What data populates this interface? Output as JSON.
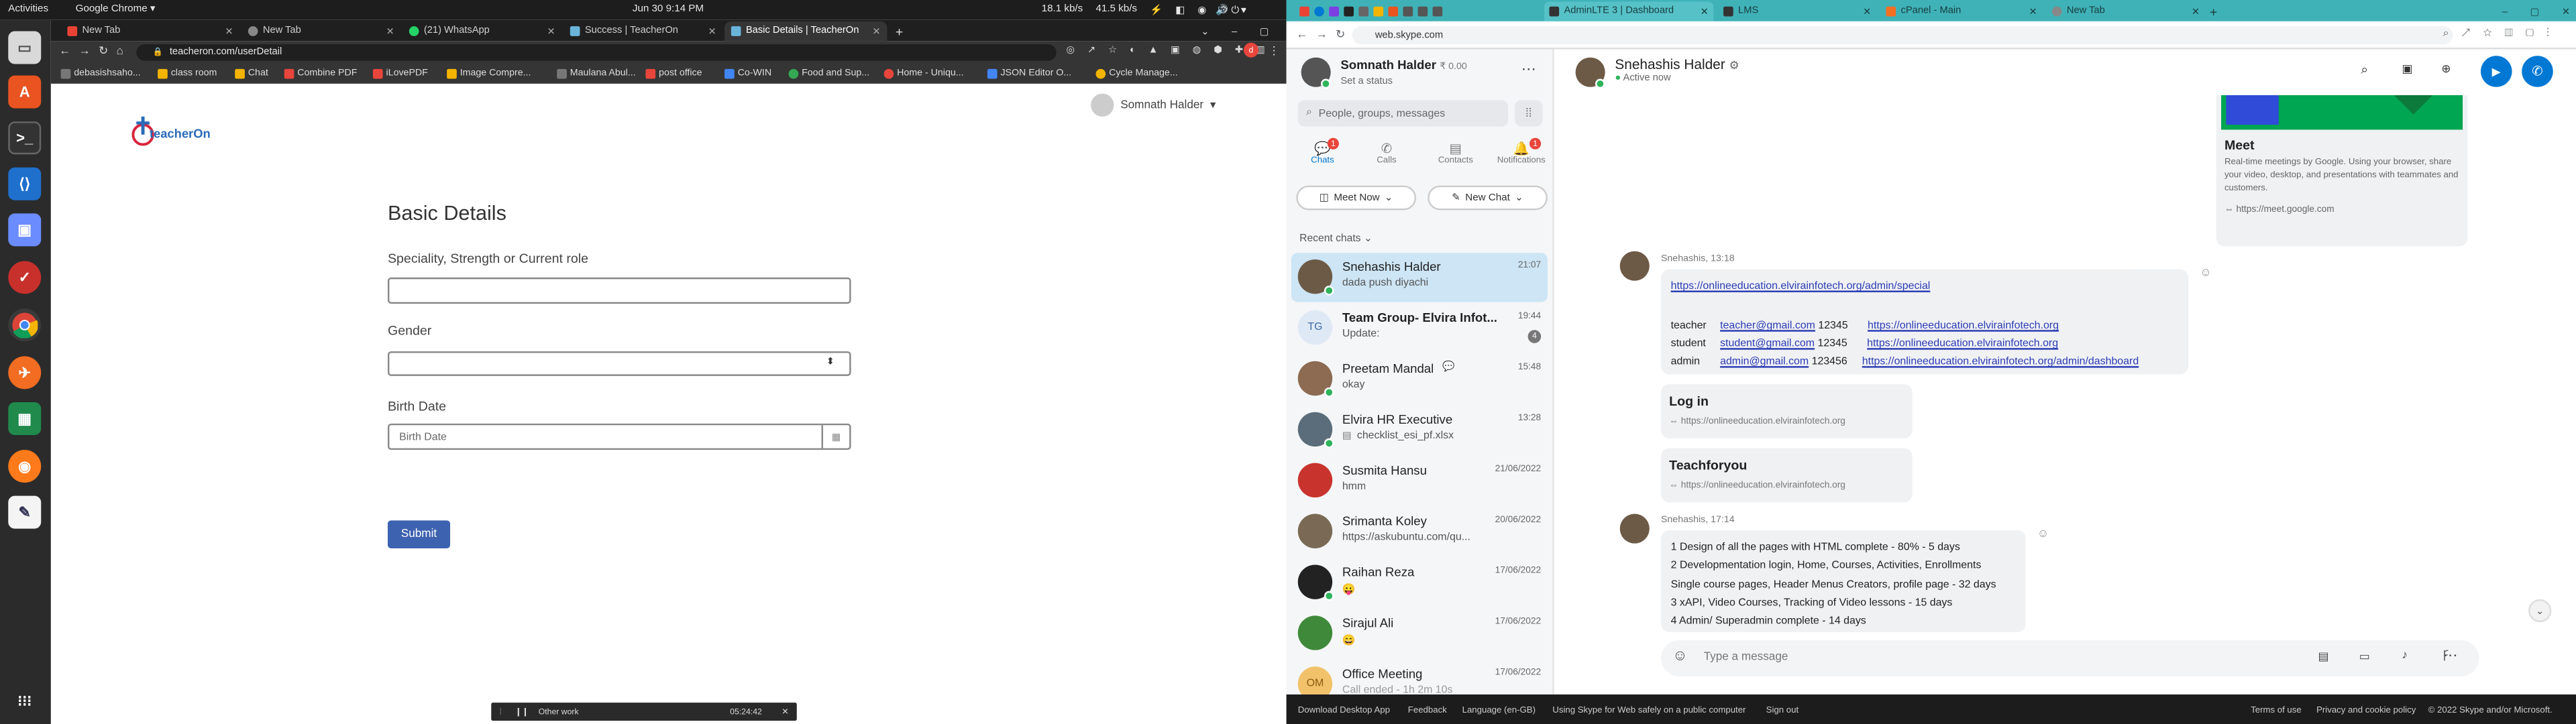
{
  "top_bar": {
    "activities": "Activities",
    "app": "Google Chrome",
    "date_time": "Jun 30  9:14 PM",
    "net1": "18.1 kb/s",
    "net2": "41.5 kb/s"
  },
  "left_browser": {
    "tabs": [
      {
        "label": "New Tab"
      },
      {
        "label": "New Tab"
      },
      {
        "label": "(21) WhatsApp"
      },
      {
        "label": "Success | TeacherOn"
      },
      {
        "label": "Basic Details | TeacherOn"
      }
    ],
    "url": "teacheron.com/userDetail",
    "bookmarks": [
      "debasishsaho...",
      "class room",
      "Chat",
      "Combine PDF",
      "iLovePDF",
      "Image Compre...",
      "Maulana Abul...",
      "post office",
      "Co-WIN",
      "Food and Sup...",
      "Home - Uniqu...",
      "JSON Editor O...",
      "Cycle Manage..."
    ],
    "page": {
      "logo_text": "teacherOn",
      "user_name": "Somnath Halder",
      "heading": "Basic Details",
      "label_role": "Speciality, Strength or Current role",
      "label_gender": "Gender",
      "label_birth": "Birth Date",
      "birth_placeholder": "Birth Date",
      "submit": "Submit"
    },
    "other_work": {
      "label": "Other work",
      "time": "05:24:42"
    }
  },
  "right_browser": {
    "tabs": [
      {
        "label": "AdminLTE 3 | Dashboard"
      },
      {
        "label": "LMS"
      },
      {
        "label": "cPanel - Main"
      },
      {
        "label": "New Tab"
      }
    ],
    "url": "web.skype.com"
  },
  "skype": {
    "me": {
      "name": "Somnath Halder",
      "credit": "₹ 0.00",
      "status": "Set a status"
    },
    "search_placeholder": "People, groups, messages",
    "nav": [
      {
        "label": "Chats",
        "badge": "1"
      },
      {
        "label": "Calls"
      },
      {
        "label": "Contacts"
      },
      {
        "label": "Notifications",
        "badge": "1"
      }
    ],
    "meet_now": "Meet Now",
    "new_chat": "New Chat",
    "recent": "Recent chats",
    "chats": [
      {
        "name": "Snehashis Halder",
        "time": "21:07",
        "preview": "dada  push diyachi"
      },
      {
        "name": "Team Group- Elvira Infot...",
        "time": "19:44",
        "preview": "Update:",
        "badge": "4",
        "initials": "TG"
      },
      {
        "name": "Preetam Mandal",
        "time": "15:48",
        "preview": "okay"
      },
      {
        "name": "Elvira HR Executive",
        "time": "13:28",
        "preview": "checklist_esi_pf.xlsx"
      },
      {
        "name": "Susmita Hansu",
        "time": "21/06/2022",
        "preview": "hmm"
      },
      {
        "name": "Srimanta Koley",
        "time": "20/06/2022",
        "preview": "https://askubuntu.com/qu..."
      },
      {
        "name": "Raihan Reza",
        "time": "17/06/2022",
        "preview": "😛"
      },
      {
        "name": "Sirajul Ali",
        "time": "17/06/2022",
        "preview": "😄"
      },
      {
        "name": "Office Meeting",
        "time": "17/06/2022",
        "preview": "Call ended - 1h 2m 10s",
        "initials": "OM"
      }
    ],
    "contact": {
      "name": "Snehashis Halder",
      "status": "Active now"
    },
    "meet_card": {
      "title": "Meet",
      "desc": "Real-time meetings by Google. Using your browser, share your video, desktop, and presentations with teammates and customers.",
      "link": "https://meet.google.com"
    },
    "msg1": {
      "sender": "Snehashis, 13:18",
      "url": "https://onlineeducation.elvirainfotech.org/admin/special",
      "rows": [
        {
          "role": "teacher",
          "email": "teacher@gmail.com",
          "pass": "12345",
          "url": "https://onlineeducation.elvirainfotech.org"
        },
        {
          "role": "student",
          "email": "student@gmail.com",
          "pass": "12345",
          "url": "https://onlineeducation.elvirainfotech.org"
        },
        {
          "role": "admin",
          "email": "admin@gmail.com",
          "pass": "123456",
          "url": "https://onlineeducation.elvirainfotech.org/admin/dashboard"
        }
      ]
    },
    "card_login": {
      "title": "Log in",
      "link": "https://onlineeducation.elvirainfotech.org"
    },
    "card_teach": {
      "title": "Teachforyou",
      "link": "https://onlineeducation.elvirainfotech.org"
    },
    "msg2": {
      "sender": "Snehashis, 17:14",
      "lines": [
        "1      Design of all the pages with HTML complete - 80% - 5 days",
        "2      Developmentation login, Home, Courses, Activities, Enrollments",
        "Single course pages, Header Menus Creators, profile page - 32 days",
        "3      xAPI, Video Courses, Tracking of Video lessons - 15 days",
        "4      Admin/ Superadmin complete - 14 days"
      ]
    },
    "compose_placeholder": "Type a message",
    "footer": {
      "download": "Download Desktop App",
      "feedback": "Feedback",
      "language": "Language (en-GB)",
      "safe": "Using Skype for Web safely on a public computer",
      "signout": "Sign out",
      "terms": "Terms of use",
      "privacy": "Privacy and cookie policy",
      "copyright": "© 2022 Skype and/or Microsoft."
    }
  },
  "colors": {
    "skype_blue": "#0078d4",
    "submit_blue": "#3d62b0",
    "teal_tabbar": "#3fb2b8",
    "unread_red": "#e8453c"
  }
}
